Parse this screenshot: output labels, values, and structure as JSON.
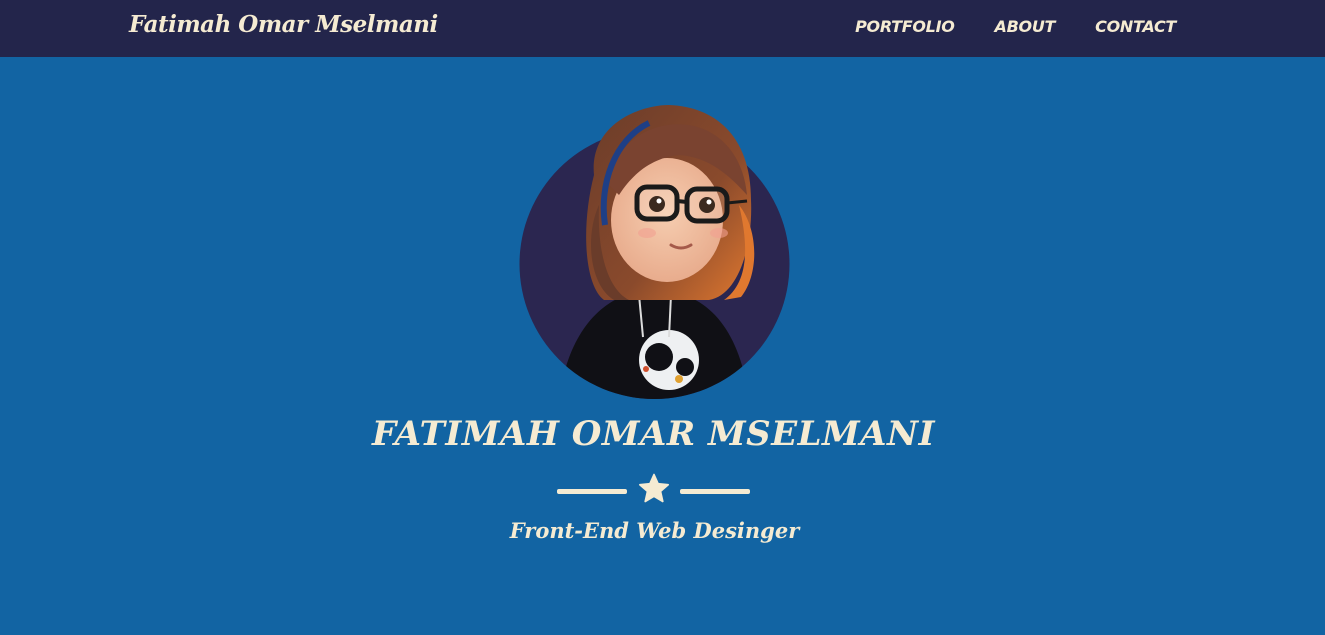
{
  "navbar": {
    "brand": "Fatimah Omar Mselmani",
    "links": [
      {
        "label": "PORTFOLIO"
      },
      {
        "label": "ABOUT"
      },
      {
        "label": "CONTACT"
      }
    ]
  },
  "hero": {
    "avatar_icon": "cartoon-girl-avatar",
    "title": "FATIMAH OMAR MSELMANI",
    "divider_icon": "star-icon",
    "subtitle": "Front-End Web Desinger"
  },
  "colors": {
    "navbar_bg": "#23254b",
    "hero_bg": "#1264a3",
    "text": "#f5ebd2",
    "avatar_circle": "#2b2650"
  }
}
